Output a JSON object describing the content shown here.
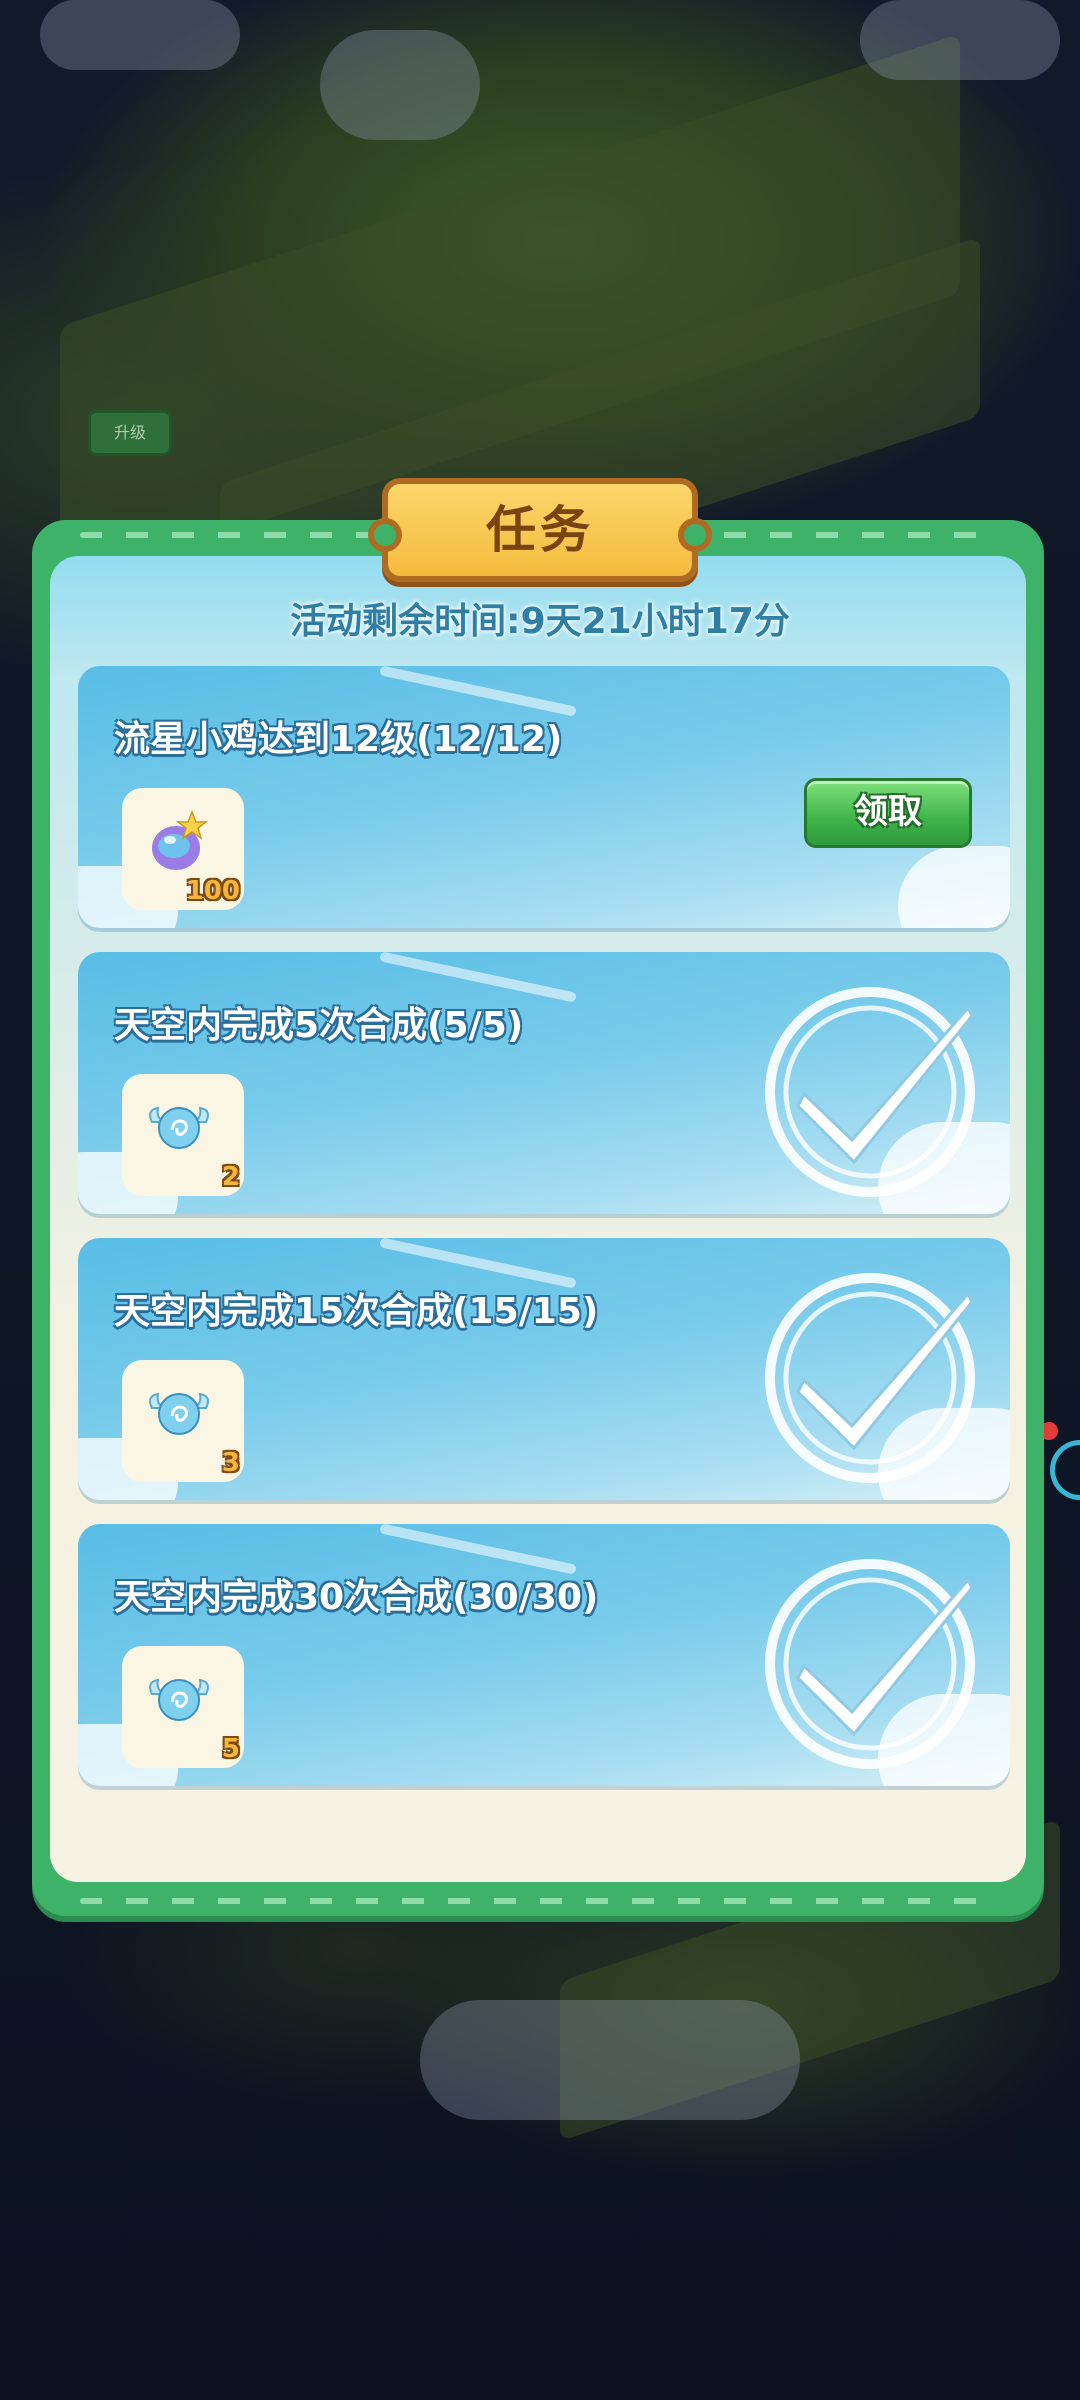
{
  "panel": {
    "title": "任务",
    "timer": "活动剩余时间:9天21小时17分"
  },
  "background": {
    "sign_label": "升级"
  },
  "tasks": [
    {
      "title": "流星小鸡达到12级(12/12)",
      "reward_icon": "purple-candy-icon",
      "reward_qty": "100",
      "status": "claimable",
      "claim_label": "领取"
    },
    {
      "title": "天空内完成5次合成(5/5)",
      "reward_icon": "wing-orb-icon",
      "reward_qty": "2",
      "status": "completed"
    },
    {
      "title": "天空内完成15次合成(15/15)",
      "reward_icon": "wing-orb-icon",
      "reward_qty": "3",
      "status": "completed"
    },
    {
      "title": "天空内完成30次合成(30/30)",
      "reward_icon": "wing-orb-icon",
      "reward_qty": "5",
      "status": "completed"
    }
  ],
  "colors": {
    "panel_frame": "#3fb26a",
    "title_tag": "#f4bb3d",
    "card_blue": "#58bde6",
    "claim_green": "#3fb34a"
  }
}
